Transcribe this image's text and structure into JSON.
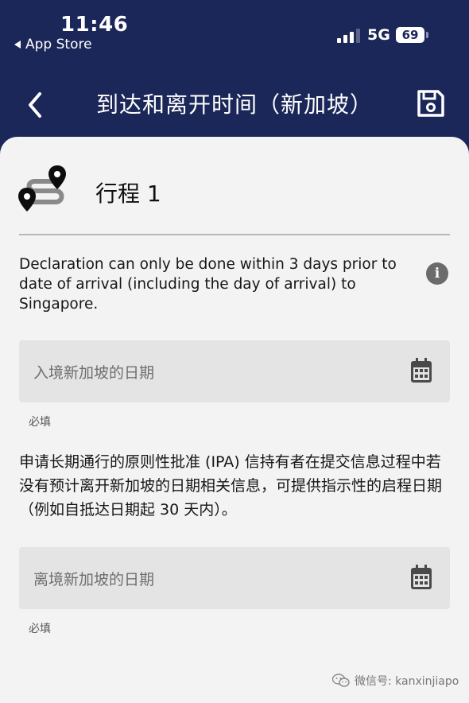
{
  "status_bar": {
    "time": "11:46",
    "back_app_label": "App Store",
    "network": "5G",
    "battery": "69"
  },
  "nav": {
    "title": "到达和离开时间（新加坡）",
    "back_icon": "chevron-left-icon",
    "save_icon": "floppy-disk-icon"
  },
  "trip": {
    "title": "行程 1",
    "icon": "route-pins-icon"
  },
  "info": {
    "text": "Declaration can only be done within 3 days prior to date of arrival (including the day of arrival) to Singapore.",
    "icon": "info-icon"
  },
  "arrival_field": {
    "placeholder": "入境新加坡的日期",
    "required_label": "必填",
    "icon": "calendar-icon"
  },
  "ipa_note": {
    "text": "申请长期通行的原则性批准 (IPA) 信持有者在提交信息过程中若没有预计离开新加坡的日期相关信息，可提供指示性的启程日期（例如自抵达日期起 30 天内）。"
  },
  "departure_field": {
    "placeholder": "离境新加坡的日期",
    "required_label": "必填",
    "icon": "calendar-icon"
  },
  "watermark": {
    "text": "微信号: kanxinjiapo",
    "icon": "wechat-icon"
  },
  "colors": {
    "header_bg": "#1b2758",
    "content_bg": "#f3f3f3",
    "field_bg": "#e4e4e4"
  }
}
